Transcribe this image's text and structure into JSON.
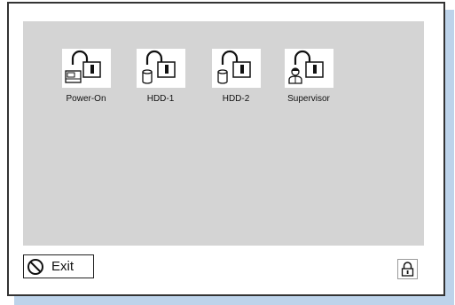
{
  "panel": {
    "items": [
      {
        "label": "Power-On",
        "icon": "power-on-lock-icon"
      },
      {
        "label": "HDD-1",
        "icon": "hdd-lock-icon"
      },
      {
        "label": "HDD-2",
        "icon": "hdd-lock-icon"
      },
      {
        "label": "Supervisor",
        "icon": "supervisor-lock-icon"
      }
    ]
  },
  "footer": {
    "exit_label": "Exit",
    "exit_icon": "no-entry-icon",
    "lock_icon": "padlock-icon"
  }
}
